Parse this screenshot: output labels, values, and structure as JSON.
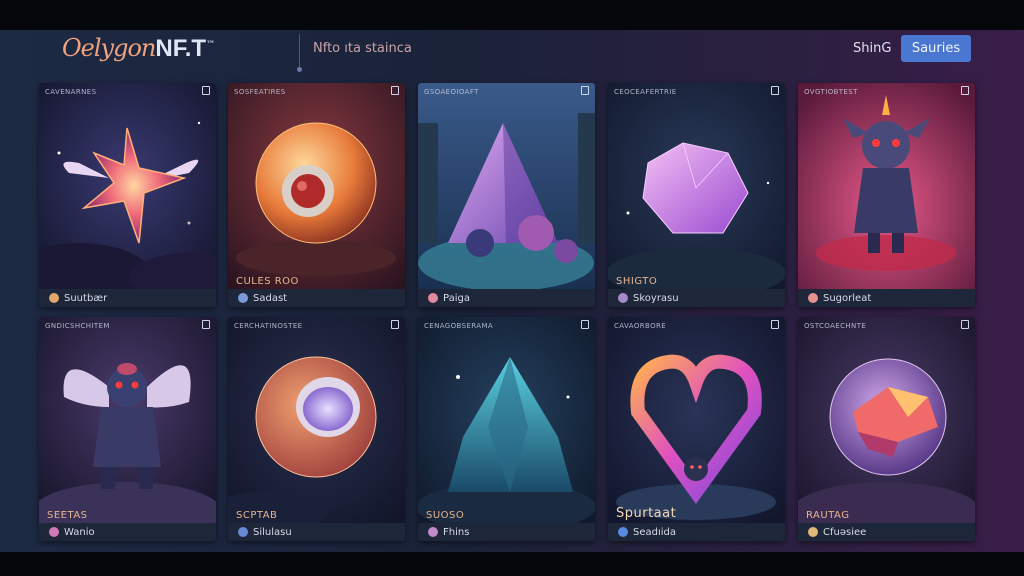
{
  "header": {
    "logo_main": "Oelygon",
    "logo_nft": "NF.T",
    "logo_tm": "™",
    "tagline": "Nfto ıta stainca",
    "link": "ShinG",
    "button": "Sauries"
  },
  "cards": [
    {
      "title": "CAVENARNES",
      "overlay": "",
      "name": "Suutbær",
      "gem_icon": "heart-gem-icon",
      "gem_color": "#e0a86a"
    },
    {
      "title": "SOSFEATIRES",
      "overlay": "CULES ROO",
      "name": "Sadast",
      "gem_icon": "orb-gem-icon",
      "gem_color": "#7a9ad8"
    },
    {
      "title": "GSOAEOIOAFT",
      "overlay": "",
      "name": "Paiga",
      "gem_icon": "heart-gem-icon",
      "gem_color": "#e08aa0"
    },
    {
      "title": "CEOCEAFERTRIE",
      "overlay": "SHIGTO",
      "name": "Skoyrasu",
      "gem_icon": "orb-gem-icon",
      "gem_color": "#a88acc"
    },
    {
      "title": "OVGTIOBTEST",
      "overlay": "",
      "name": "Sugorleat",
      "gem_icon": "heart-gem-icon",
      "gem_color": "#e69090"
    },
    {
      "title": "GNDICSHCHITEM",
      "overlay": "SEETAS",
      "name": "Wanio",
      "gem_icon": "heart-gem-icon",
      "gem_color": "#d07ab8"
    },
    {
      "title": "CERCHATINOSTEE",
      "overlay": "SCPTAB",
      "name": "Silulasu",
      "gem_icon": "orb-gem-icon",
      "gem_color": "#6a8ad8"
    },
    {
      "title": "CENAGOBSERAMA",
      "overlay": "SUOSO",
      "name": "Fhins",
      "gem_icon": "heart-gem-icon",
      "gem_color": "#c08ac8"
    },
    {
      "title": "CAVAORBORE",
      "overlay": "Spurtaat",
      "name": "Seadıida",
      "gem_icon": "orb-gem-icon",
      "gem_color": "#5a8ae0"
    },
    {
      "title": "OSTCOAECHNTE",
      "overlay": "RAUTAG",
      "name": "Cfuəsiee",
      "gem_icon": "heart-gem-icon",
      "gem_color": "#e0b87a"
    }
  ],
  "colors": {
    "accent": "#4a77d0",
    "logo": "#f0a27c",
    "frame_left": "#1d2a44",
    "frame_right": "#3a1d48"
  }
}
